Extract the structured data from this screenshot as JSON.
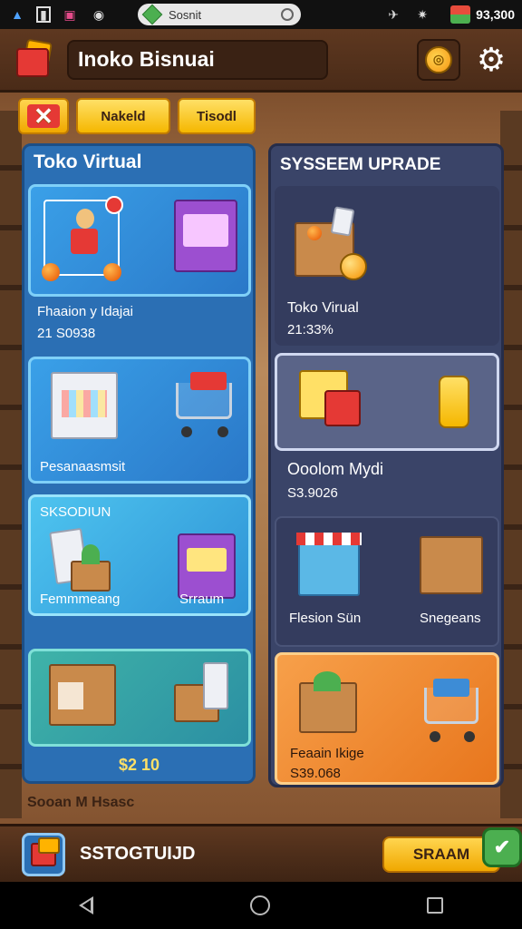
{
  "statusbar": {
    "search_text": "Sosnit",
    "money": "93,300"
  },
  "header": {
    "title": "Inoko Bisnuai"
  },
  "tabs": {
    "tab1": "Nakeld",
    "tab2": "Tisodl"
  },
  "left_panel": {
    "title": "Toko Virtual",
    "cards": [
      {
        "label": "Fhaaion y Idajai",
        "value": "21 S0938"
      },
      {
        "label": "Pesanaasmsit"
      },
      {
        "label": "SKSODIUN",
        "label2": "Femmmeang",
        "label3": "Srraum"
      },
      {
        "value": "$2 10"
      }
    ]
  },
  "right_panel": {
    "title": "SYSSEEM UPRADE",
    "cards": [
      {
        "label": "Toko Virual",
        "value": "21:33%"
      },
      {
        "label": ""
      },
      {
        "label": "Ooolom Mydi",
        "value": "S3.9026"
      },
      {
        "label": "Flesion Sün",
        "label2": "Snegeans"
      },
      {
        "label": "Feaain Ikige",
        "value": "S39.068"
      }
    ]
  },
  "footer_label": "Sooan M Hsasc",
  "actionbar": {
    "title": "SSTOGTUIJD",
    "button": "SRAAM"
  }
}
